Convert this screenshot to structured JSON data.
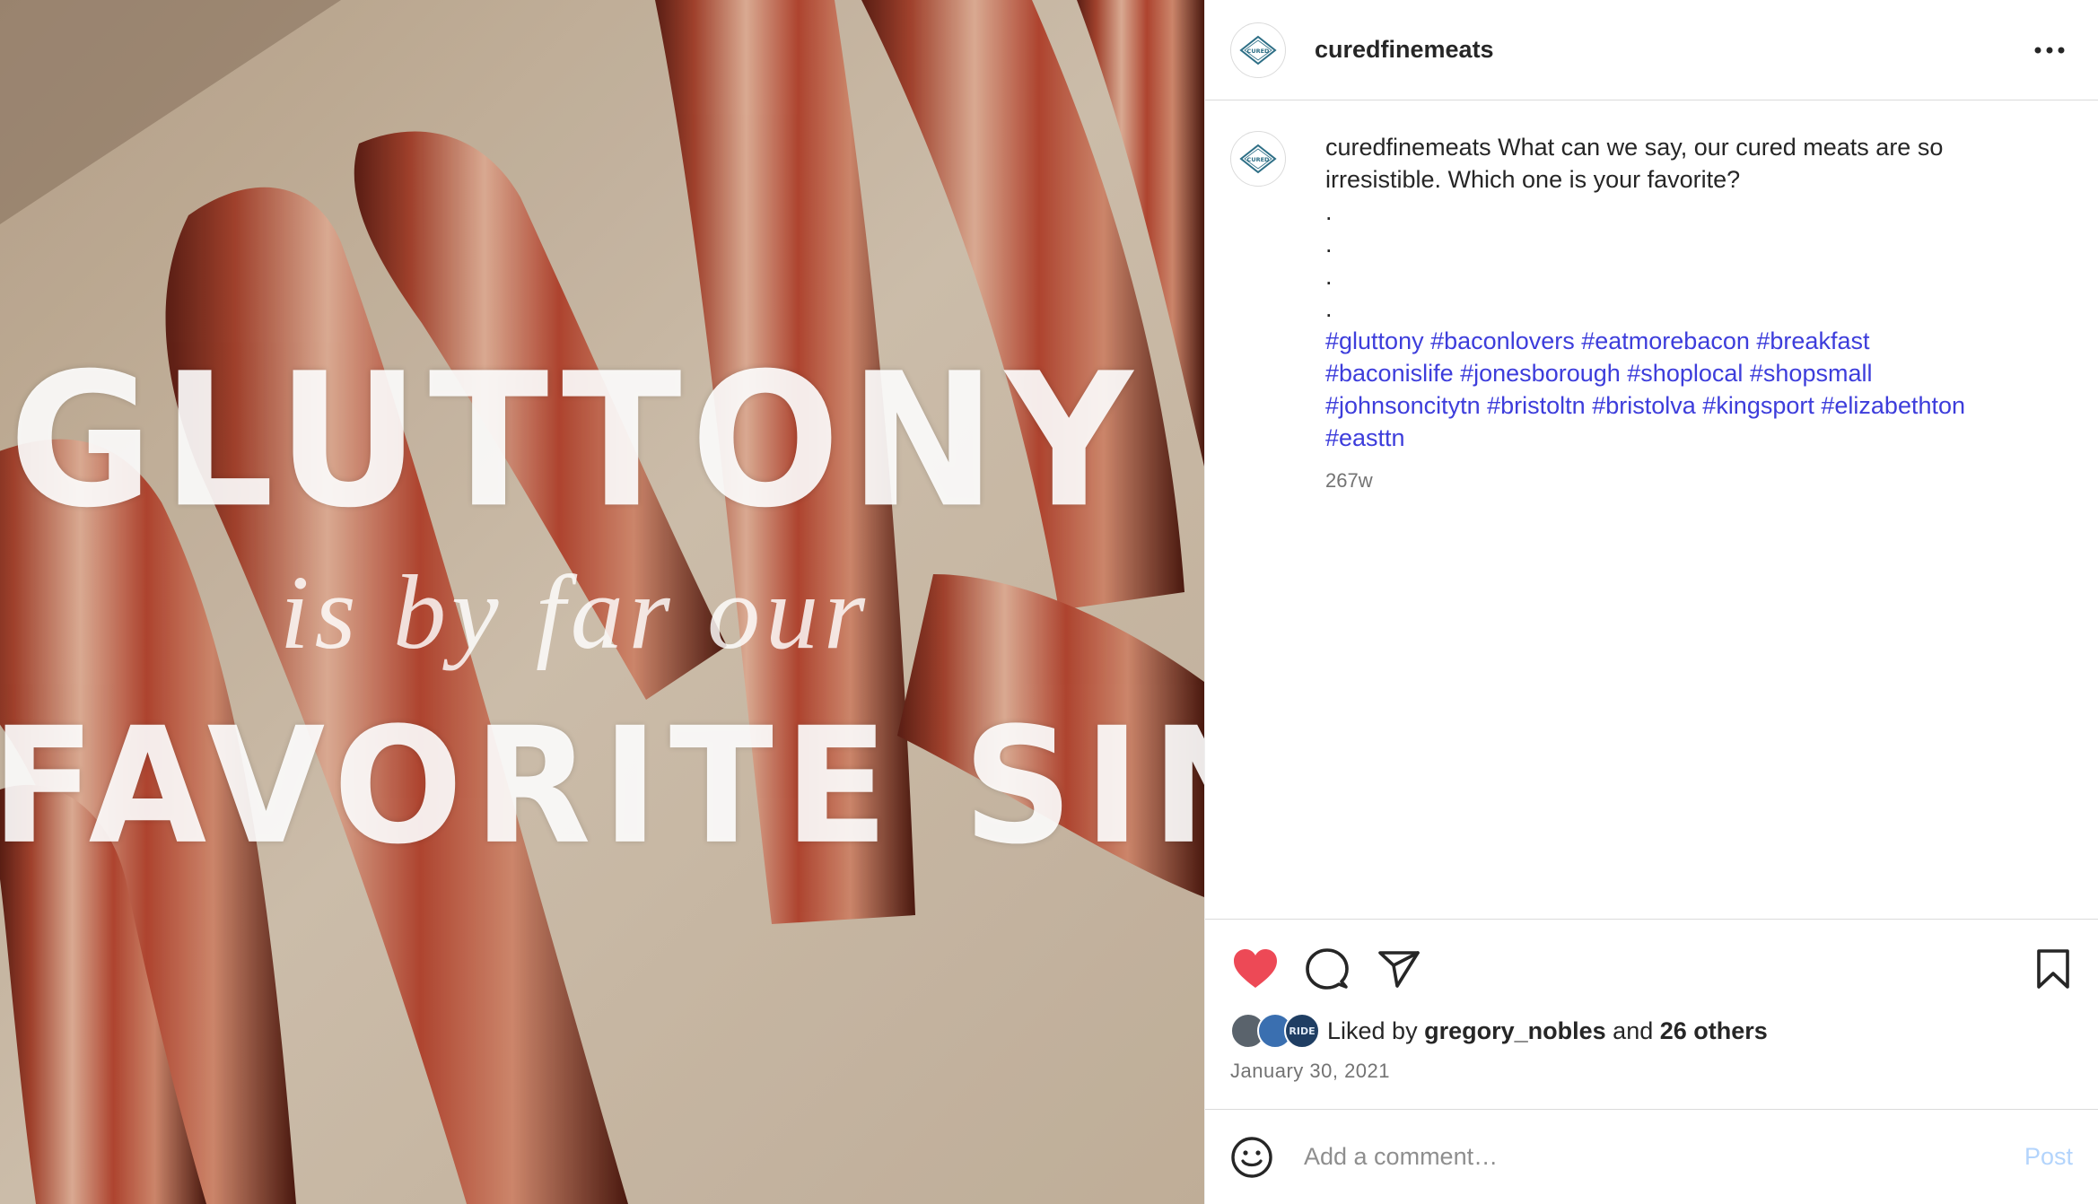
{
  "media": {
    "overlay_line_1": "GLUTTONY",
    "overlay_line_2": "is by far our",
    "overlay_line_3": "FAVORITE SIN"
  },
  "header": {
    "avatar_label": "CURED",
    "username": "curedfinemeats",
    "more_icon": "more-horizontal-icon"
  },
  "caption": {
    "avatar_label": "CURED",
    "username": "curedfinemeats",
    "text": "What can we say, our cured meats are so irresistible. Which one is your favorite?",
    "dots": [
      ".",
      ".",
      ".",
      "."
    ],
    "hashtags": [
      "#gluttony",
      "#baconlovers",
      "#eatmorebacon",
      "#breakfast",
      "#baconislife",
      "#jonesborough",
      "#shoplocal",
      "#shopsmall",
      "#johnsoncitytn",
      "#bristoltn",
      "#bristolva",
      "#kingsport",
      "#elizabethton",
      "#easttn"
    ],
    "age": "267w"
  },
  "actions": {
    "like_icon": "heart-filled-icon",
    "comment_icon": "comment-bubble-icon",
    "share_icon": "paper-plane-icon",
    "save_icon": "bookmark-icon",
    "like_color": "#ed4956"
  },
  "likes": {
    "prefix": "Liked by",
    "user": "gregory_nobles",
    "conjunction": "and",
    "others": "26 others",
    "avatar_3_label": "RIDE"
  },
  "date": "January 30, 2021",
  "comment": {
    "emoji_icon": "smiley-icon",
    "placeholder": "Add a comment…",
    "post_label": "Post"
  }
}
